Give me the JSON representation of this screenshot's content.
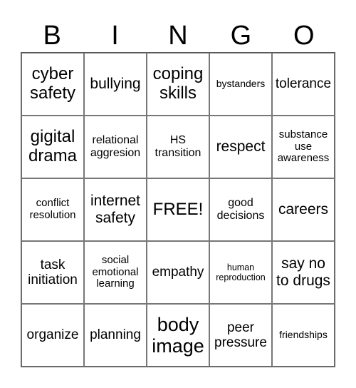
{
  "header": {
    "letters": [
      "B",
      "I",
      "N",
      "G",
      "O"
    ]
  },
  "cells": [
    "cyber safety",
    "bullying",
    "coping skills",
    "bystanders",
    "tolerance",
    "gigital drama",
    "relational aggresion",
    "HS transition",
    "respect",
    "substance use awareness",
    "conflict resolution",
    "internet safety",
    "FREE!",
    "good decisions",
    "careers",
    "task initiation",
    "social emotional learning",
    "empathy",
    "human reproduction",
    "say no to drugs",
    "organize",
    "planning",
    "body image",
    "peer pressure",
    "friendships"
  ]
}
